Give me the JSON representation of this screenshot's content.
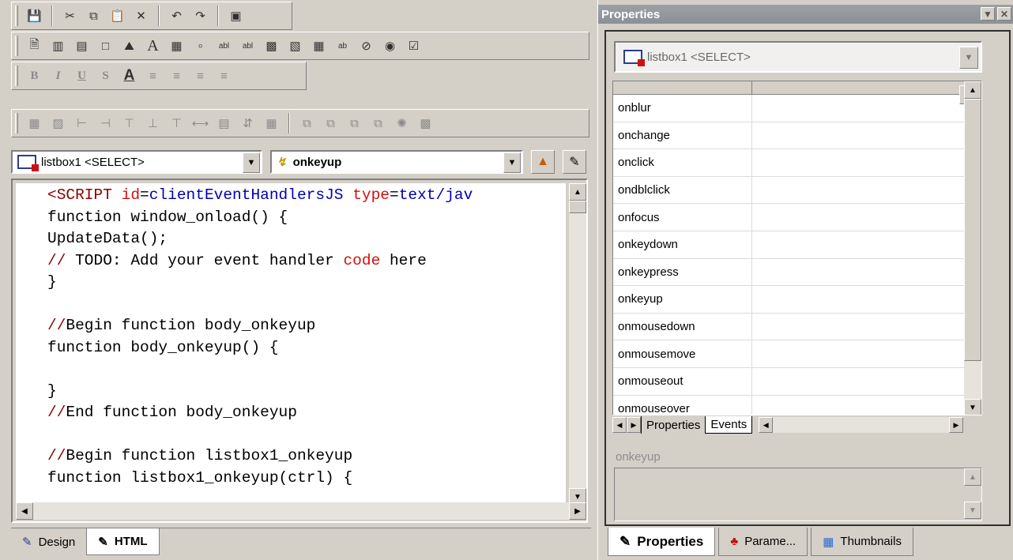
{
  "toolbars": {
    "row1_icons": [
      "save-icon",
      "cut-icon",
      "copy-icon",
      "paste-icon",
      "delete-icon",
      "undo-icon",
      "redo-icon",
      "refresh-icon"
    ],
    "row2_icons": [
      "page-icon",
      "chart-icon",
      "form-icon",
      "frame-icon",
      "image-icon",
      "label-icon",
      "table-icon",
      "textarea-icon",
      "textbox-icon",
      "password-icon",
      "listbox-icon",
      "combobox-icon",
      "grid-icon",
      "button-icon",
      "no-icon",
      "radio-icon",
      "checkbox-icon"
    ],
    "format": {
      "bold": "B",
      "italic": "I",
      "underline": "U",
      "strike": "S",
      "color": "A"
    },
    "row4_icons": [
      "grid-toggle-icon",
      "snap-icon",
      "align-left-icon",
      "align-right-icon",
      "align-top-icon",
      "align-bottom-icon",
      "center-icon",
      "same-width-icon",
      "same-height-icon",
      "space-icon",
      "space-across-icon",
      "order1-icon",
      "order2-icon",
      "order3-icon",
      "order4-icon",
      "order5-icon",
      "order6-icon"
    ]
  },
  "object_combo": {
    "value": "listbox1 <SELECT>"
  },
  "event_combo": {
    "value": "onkeyup"
  },
  "code": {
    "lines": [
      {
        "parts": [
          {
            "t": "<SCRIPT",
            "c": "kw"
          },
          {
            "t": " ",
            "c": ""
          },
          {
            "t": "id",
            "c": "attr"
          },
          {
            "t": "=",
            "c": ""
          },
          {
            "t": "clientEventHandlersJS",
            "c": "val"
          },
          {
            "t": " ",
            "c": ""
          },
          {
            "t": "type",
            "c": "attr"
          },
          {
            "t": "=",
            "c": ""
          },
          {
            "t": "text/jav",
            "c": "val"
          }
        ]
      },
      {
        "parts": [
          {
            "t": "function window_onload() {",
            "c": ""
          }
        ]
      },
      {
        "parts": [
          {
            "t": "UpdateData();",
            "c": ""
          }
        ]
      },
      {
        "parts": [
          {
            "t": "//",
            "c": "cm"
          },
          {
            "t": " TODO: Add your event handler ",
            "c": ""
          },
          {
            "t": "code",
            "c": "red"
          },
          {
            "t": " here",
            "c": ""
          }
        ]
      },
      {
        "parts": [
          {
            "t": "}",
            "c": ""
          }
        ]
      },
      {
        "parts": [
          {
            "t": "",
            "c": ""
          }
        ]
      },
      {
        "parts": [
          {
            "t": "//",
            "c": "cm"
          },
          {
            "t": "Begin function body_onkeyup",
            "c": ""
          }
        ]
      },
      {
        "parts": [
          {
            "t": "function body_onkeyup() {",
            "c": ""
          }
        ]
      },
      {
        "parts": [
          {
            "t": "",
            "c": ""
          }
        ]
      },
      {
        "parts": [
          {
            "t": "}",
            "c": ""
          }
        ]
      },
      {
        "parts": [
          {
            "t": "//",
            "c": "cm"
          },
          {
            "t": "End function body_onkeyup",
            "c": ""
          }
        ]
      },
      {
        "parts": [
          {
            "t": "",
            "c": ""
          }
        ]
      },
      {
        "parts": [
          {
            "t": "//",
            "c": "cm"
          },
          {
            "t": "Begin function listbox1_onkeyup",
            "c": ""
          }
        ]
      },
      {
        "parts": [
          {
            "t": "function listbox1_onkeyup(ctrl) {",
            "c": ""
          }
        ]
      }
    ]
  },
  "editor_tabs": [
    {
      "label": "Design",
      "icon": "design-icon",
      "active": false
    },
    {
      "label": "HTML",
      "icon": "html-icon",
      "active": true
    }
  ],
  "properties_panel": {
    "title": "Properties",
    "object": "listbox1 <SELECT>",
    "events": [
      {
        "name": "onblur",
        "value": ""
      },
      {
        "name": "onchange",
        "value": ""
      },
      {
        "name": "onclick",
        "value": ""
      },
      {
        "name": "ondblclick",
        "value": ""
      },
      {
        "name": "onfocus",
        "value": ""
      },
      {
        "name": "onkeydown",
        "value": ""
      },
      {
        "name": "onkeypress",
        "value": ""
      },
      {
        "name": "onkeyup",
        "value": "",
        "ellipsis": "..."
      },
      {
        "name": "onmousedown",
        "value": ""
      },
      {
        "name": "onmousemove",
        "value": ""
      },
      {
        "name": "onmouseout",
        "value": ""
      },
      {
        "name": "onmouseover",
        "value": ""
      }
    ],
    "grid_tabs": [
      "Properties",
      "Events"
    ],
    "active_grid_tab": "Events",
    "description_label": "onkeyup"
  },
  "bottom_right_tabs": [
    {
      "label": "Properties",
      "icon": "properties-icon",
      "active": true
    },
    {
      "label": "Parame...",
      "icon": "parameters-icon",
      "active": false
    },
    {
      "label": "Thumbnails",
      "icon": "thumbnails-icon",
      "active": false
    }
  ]
}
